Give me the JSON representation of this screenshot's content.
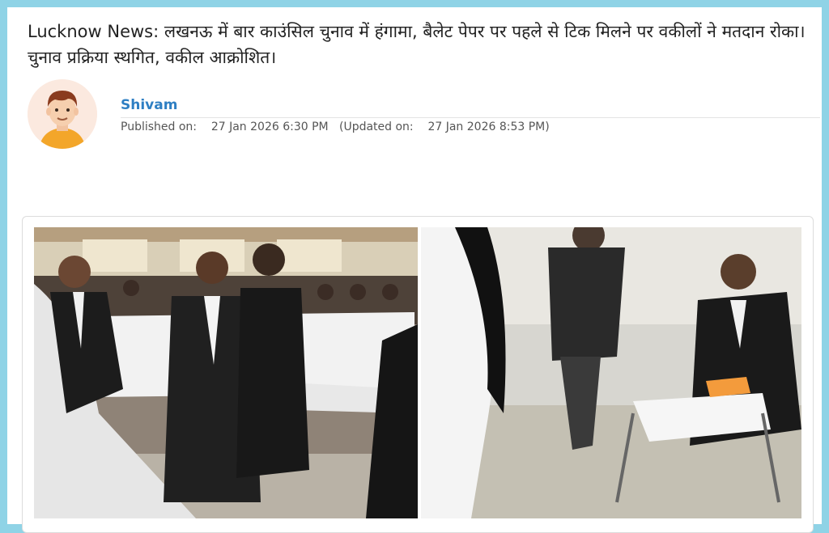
{
  "article": {
    "headline": "Lucknow News: लखनऊ में बार काउंसिल चुनाव में हंगामा, बैलेट पेपर पर पहले से टिक मिलने पर वकीलों ने मतदान रोका। चुनाव प्रक्रिया स्थगित, वकील आक्रोशित।",
    "author": {
      "name": "Shivam",
      "published_label": "Published on:",
      "published_at": "27 Jan 2026 6:30 PM",
      "updated_label": "(Updated on:",
      "updated_at": "27 Jan 2026 8:53 PM)"
    },
    "image": {
      "icon": "news-photo-collage"
    }
  },
  "colors": {
    "background_border": "#8fd3e6",
    "author_link": "#2e7fc3",
    "text": "#222222",
    "meta_text": "#555555"
  }
}
